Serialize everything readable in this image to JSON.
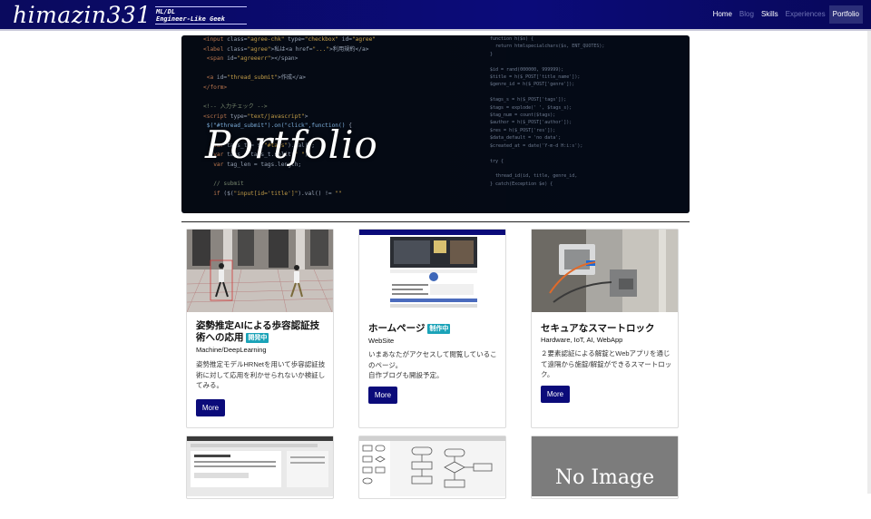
{
  "navbar": {
    "brand": "himazin331",
    "brand_sub_line1": "ML/DL",
    "brand_sub_line2": "Engineer-Like Geek",
    "items": [
      {
        "label": "Home",
        "state": "normal"
      },
      {
        "label": "Blog",
        "state": "dim"
      },
      {
        "label": "Skills",
        "state": "normal"
      },
      {
        "label": "Experiences",
        "state": "dim"
      },
      {
        "label": "Portfolio",
        "state": "active"
      }
    ]
  },
  "hero": {
    "title": "Portfolio"
  },
  "cards": [
    {
      "title": "姿勢推定AIによる歩容認証技術への応用",
      "badge": "開発中",
      "category": "Machine/DeepLearning",
      "description": "姿勢推定モデルHRNetを用いて歩容認証技術に対して応用を利かせられないか検証してみる。",
      "button": "More"
    },
    {
      "title": "ホームページ",
      "badge": "制作中",
      "category": "WebSite",
      "description": "いまあなたがアクセスして閲覧しているこのページ。\n自作ブログも開設予定。",
      "button": "More"
    },
    {
      "title": "セキュアなスマートロック",
      "badge": "",
      "category": "Hardware, IoT, AI, WebApp",
      "description": "２要素認証による解錠とWebアプリを通じて遠隔から施錠/解錠ができるスマートロック。",
      "button": "More"
    }
  ],
  "bottom_row": {
    "no_image_label": "No Image"
  },
  "colors": {
    "navbar": "#0b0b7a",
    "button": "#0b0b7a",
    "badge": "#1aa3b8"
  }
}
